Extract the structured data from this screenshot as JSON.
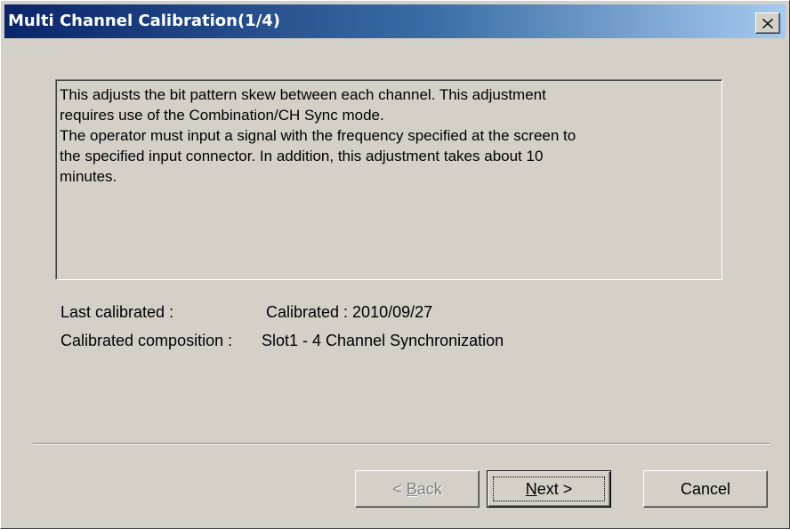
{
  "window": {
    "title": "Multi Channel Calibration(1/4)"
  },
  "description": {
    "lines": [
      "This adjusts the bit pattern skew between each channel. This adjustment",
      "requires use of the Combination/CH Sync mode.",
      "The operator must input a signal with the frequency specified at the screen to",
      "the specified input connector. In addition, this adjustment takes about 10",
      "minutes."
    ]
  },
  "info": {
    "last_calibrated_label": "Last calibrated :",
    "last_calibrated_value": "Calibrated : 2010/09/27",
    "composition_label": "Calibrated composition :",
    "composition_value": "Slot1 - 4 Channel Synchronization"
  },
  "buttons": {
    "back": {
      "prefix": "< ",
      "mnemonic": "B",
      "rest": "ack",
      "enabled": false
    },
    "next": {
      "mnemonic": "N",
      "rest": "ext >",
      "enabled": true,
      "default": true
    },
    "cancel": {
      "label": "Cancel",
      "enabled": true
    }
  },
  "icons": {
    "close": "close-icon"
  },
  "colors": {
    "face": "#d4d0c8",
    "title_start": "#0a246a",
    "title_end": "#a6caf0",
    "disabled_text": "#808080"
  }
}
